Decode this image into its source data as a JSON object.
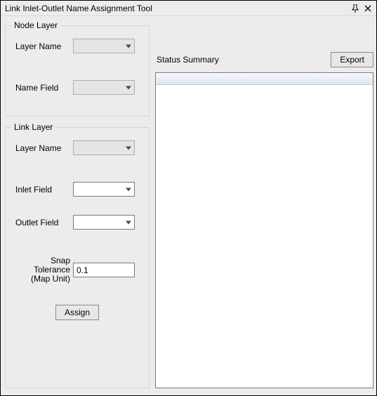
{
  "title": "Link Inlet-Outlet Name Assignment Tool",
  "node_layer": {
    "legend": "Node Layer",
    "layer_name_label": "Layer Name",
    "layer_name_value": "",
    "name_field_label": "Name Field",
    "name_field_value": ""
  },
  "link_layer": {
    "legend": "Link Layer",
    "layer_name_label": "Layer Name",
    "layer_name_value": "",
    "inlet_field_label": "Inlet Field",
    "inlet_field_value": "",
    "outlet_field_label": "Outlet Field",
    "outlet_field_value": "",
    "snap_tolerance_label_l1": "Snap Tolerance",
    "snap_tolerance_label_l2": "(Map Unit)",
    "snap_tolerance_value": "0.1",
    "assign_label": "Assign"
  },
  "status": {
    "label": "Status Summary",
    "export_label": "Export"
  }
}
